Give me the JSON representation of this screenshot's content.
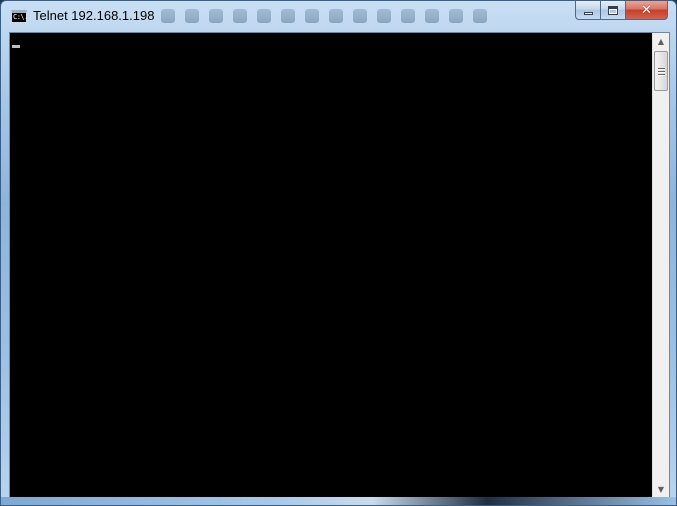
{
  "window": {
    "title": "Telnet 192.168.1.198",
    "icon_text": "C:\\.",
    "icon": "console-window-icon"
  },
  "caption_buttons": {
    "minimize_icon": "minimize-icon",
    "maximize_icon": "maximize-icon",
    "close_icon": "close-icon",
    "close_glyph": "✕"
  },
  "console": {
    "background": "#000000",
    "cursor_color": "#c0c0c0"
  },
  "scrollbar": {
    "up_glyph": "▲",
    "down_glyph": "▼"
  }
}
